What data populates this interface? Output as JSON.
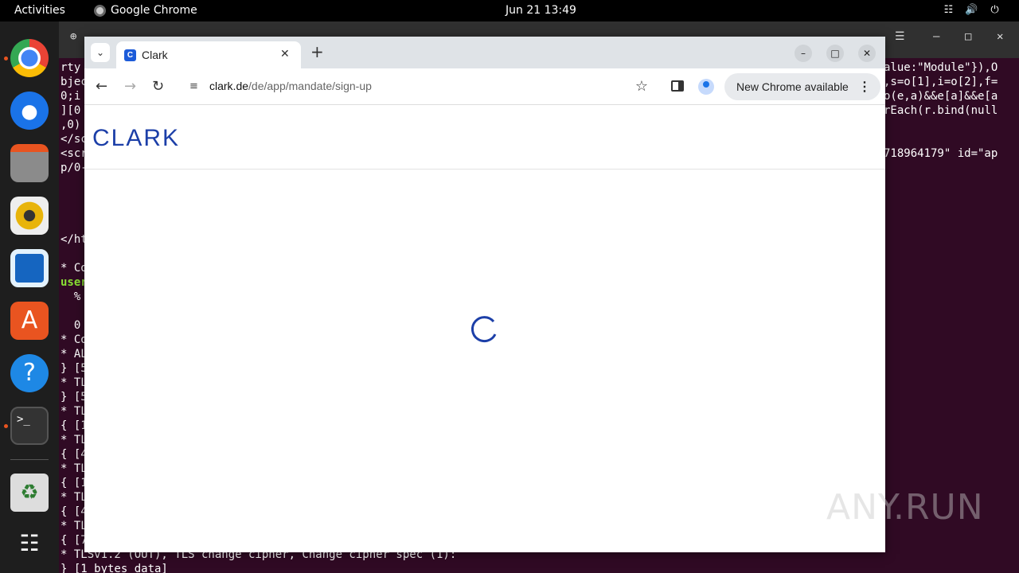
{
  "topbar": {
    "activities": "Activities",
    "app_name": "Google Chrome",
    "clock": "Jun 21  13:49"
  },
  "dock": {
    "items": [
      "chrome-icon",
      "thunderbird-icon",
      "files-icon",
      "rhythmbox-icon",
      "writer-icon",
      "app-center-icon",
      "help-icon",
      "terminal-icon",
      "trash-icon",
      "app-grid-icon"
    ]
  },
  "terminal": {
    "lines": [
      "rty",
      "bjec",
      "0;i",
      "][0",
      ",0)",
      "</sc",
      "<scr",
      "p/0-",
      "</ht",
      "* Co",
      "user",
      "  %",
      "  0",
      "* Co",
      "* AL",
      "} [5",
      "* TL",
      "} [5",
      "* TL",
      "{ [1",
      "* TL",
      "{ [4",
      "* TL",
      "{ [1",
      "* TL",
      "{ [4",
      "* TL",
      "{ [7",
      "* TLSv1.2 (OUT), TLS change cipher, Change cipher spec (1):",
      "} [1 bytes data]"
    ],
    "right_lines": [
      "alue:\"Module\"}),O",
      ",s=o[1],i=o[2],f=",
      "o(e,a)&&e[a]&&e[a",
      "rEach(r.bind(null",
      "",
      "718964179\" id=\"ap"
    ]
  },
  "chrome": {
    "tab_title": "Clark",
    "tab_favicon_letter": "C",
    "url_host": "clark.de",
    "url_path": "/de/app/mandate/sign-up",
    "update_label": "New Chrome available"
  },
  "page": {
    "logo": "CLARK"
  },
  "watermark": "ANY.RUN"
}
